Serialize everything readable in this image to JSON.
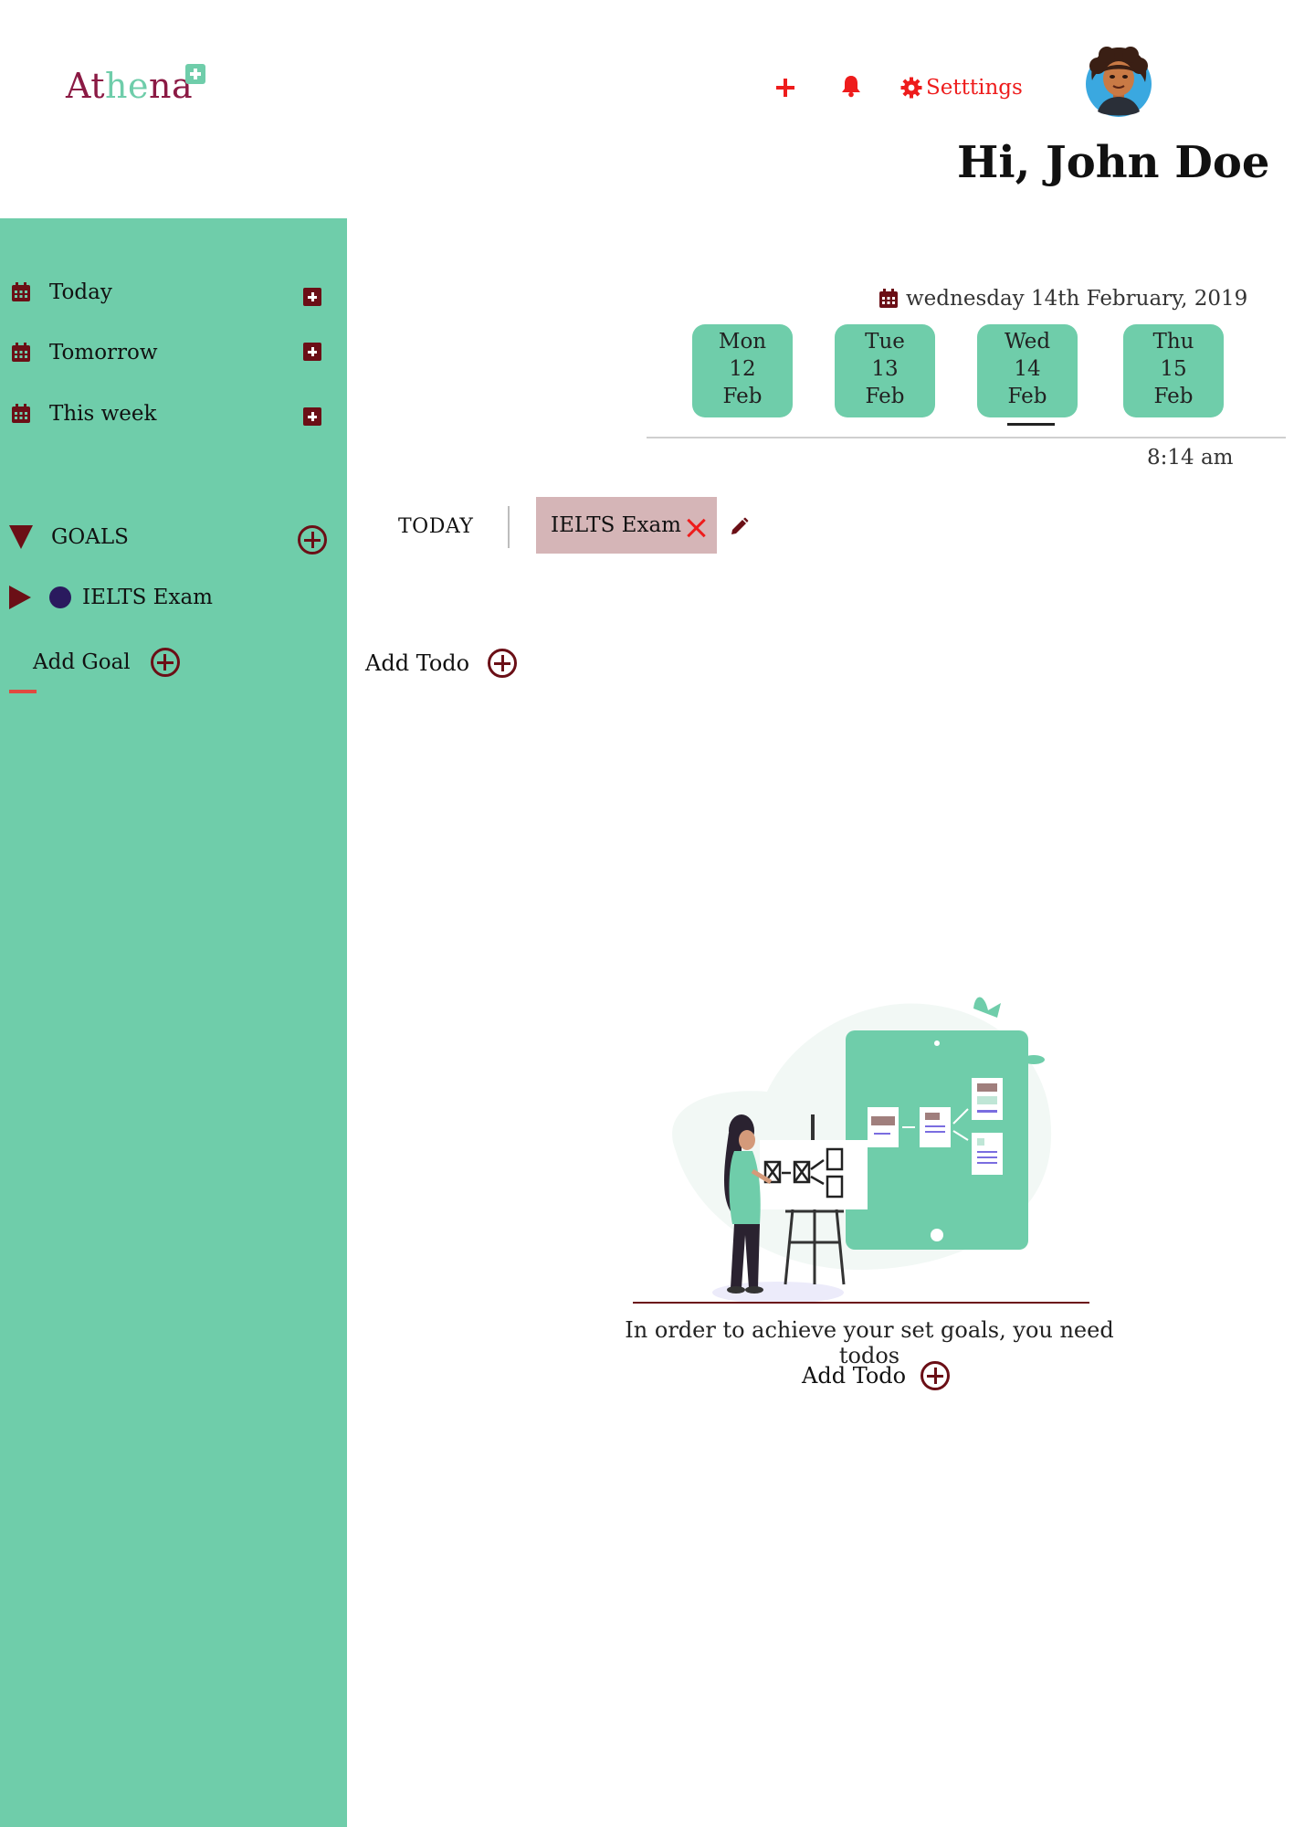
{
  "app": {
    "logo_part1": "At",
    "logo_part2": "he",
    "logo_part3": "na"
  },
  "header": {
    "settings_label": "Setttings",
    "greeting": "Hi, John Doe"
  },
  "sidebar": {
    "items": [
      {
        "label": "Today"
      },
      {
        "label": "Tomorrow"
      },
      {
        "label": "This week"
      }
    ],
    "goals_heading": "GOALS",
    "goals": [
      {
        "label": "IELTS Exam"
      }
    ],
    "add_goal_label": "Add Goal"
  },
  "calendar": {
    "current_date": "wednesday 14th February, 2019",
    "days": [
      {
        "weekday": "Mon",
        "day": "12",
        "month": "Feb"
      },
      {
        "weekday": "Tue",
        "day": "13",
        "month": "Feb"
      },
      {
        "weekday": "Wed",
        "day": "14",
        "month": "Feb"
      },
      {
        "weekday": "Thu",
        "day": "15",
        "month": "Feb"
      }
    ],
    "time": "8:14 am"
  },
  "tabs": {
    "today_label": "TODAY",
    "goal_tab_label": "IELTS Exam"
  },
  "main": {
    "add_todo_label": "Add Todo",
    "empty_message": "In order to achieve your set goals, you need todos",
    "empty_add_todo_label": "Add Todo"
  },
  "colors": {
    "accent_green": "#6fcdaa",
    "brand_maroon": "#6b0f16",
    "alert_red": "#ee1c1c",
    "goal_tab_bg": "#d5b5b7"
  },
  "icons": [
    "plus-icon",
    "bell-icon",
    "gear-icon",
    "calendar-icon",
    "add-square-icon",
    "circle-plus-icon",
    "close-icon",
    "pencil-icon",
    "triangle-down-icon",
    "play-icon"
  ]
}
